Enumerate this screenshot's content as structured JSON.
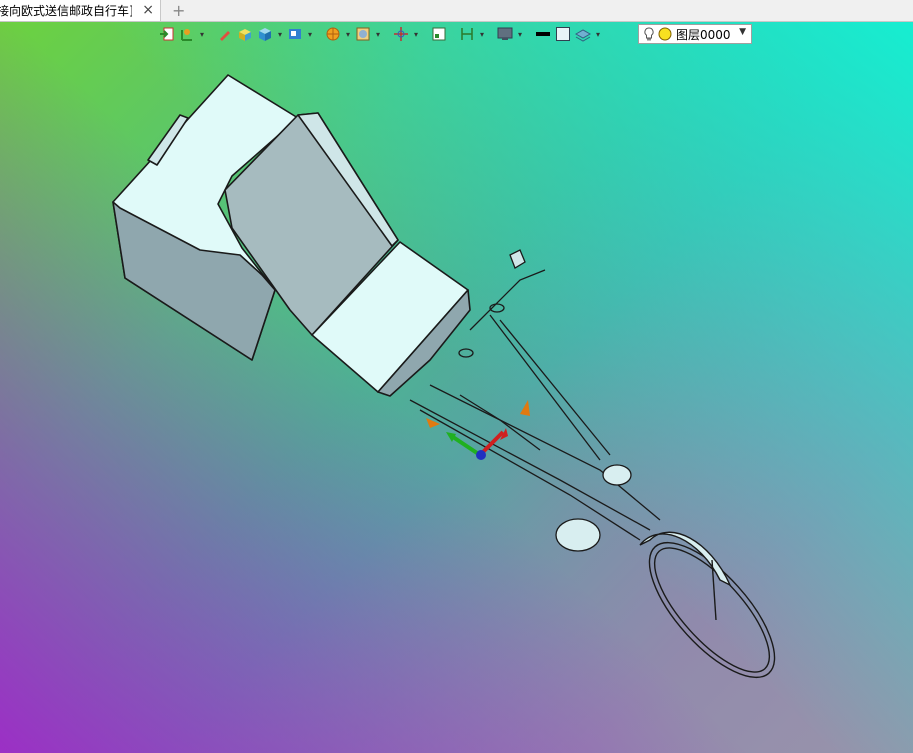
{
  "tab": {
    "title": "接向欧式送信邮政自行车]",
    "close_icon": "×",
    "add_icon": "+"
  },
  "toolbar": {
    "items": [
      "import-icon",
      "transform-icon",
      "pencil-icon",
      "box-icon",
      "cube-icon",
      "view-icon",
      "render-sphere-icon",
      "material-icon",
      "move-icon",
      "frame-icon",
      "dimension-icon",
      "display-icon",
      "color-black-icon",
      "color-white-icon",
      "layers-icon"
    ]
  },
  "layer": {
    "value": "图层0000",
    "dropdown_icon": "▼"
  },
  "colors": {
    "box_face": "#e0faf9",
    "box_side": "#8da6ae",
    "lines": "#1a1a1a"
  }
}
